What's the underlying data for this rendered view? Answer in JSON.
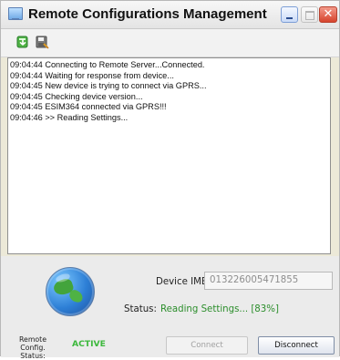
{
  "window": {
    "title": "Remote Configurations Management"
  },
  "controls": {
    "minimize": "minimize",
    "maximize": "maximize",
    "close": "close"
  },
  "toolbar": {
    "icons": [
      "green-download-icon",
      "save-icon"
    ]
  },
  "log": {
    "lines": [
      "09:04:44 Connecting to Remote Server...Connected.",
      "09:04:44 Waiting for response from device...",
      "09:04:45 New device is trying to connect via GPRS...",
      "09:04:45 Checking device version...",
      "09:04:45 ESIM364 connected via GPRS!!!",
      "09:04:46 >> Reading Settings..."
    ]
  },
  "device": {
    "imei_label": "Device IMEI:",
    "imei_value": "013226005471855",
    "status_label": "Status:",
    "status_value": "Reading Settings... [83%]"
  },
  "remote": {
    "label_line1": "Remote Config.",
    "label_line2": "Status:",
    "status_value": "ACTIVE"
  },
  "buttons": {
    "connect": "Connect",
    "disconnect": "Disconnect"
  }
}
